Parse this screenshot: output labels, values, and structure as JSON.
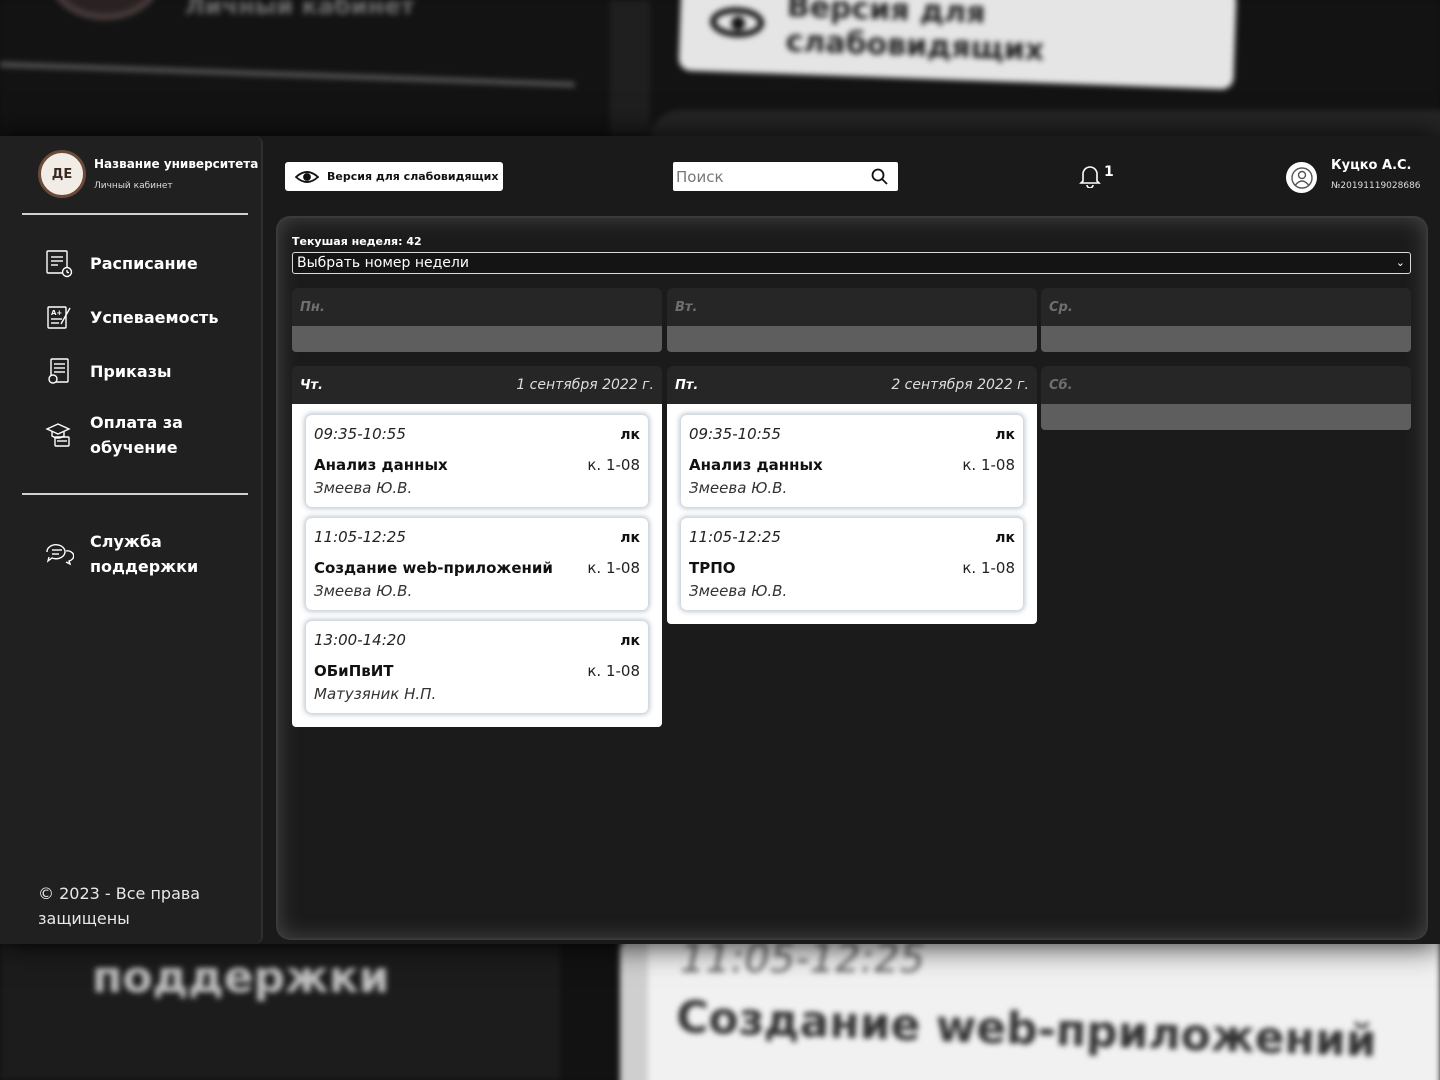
{
  "backdrop": {
    "top_cabinet": "Личный кабинет",
    "top_button": "Версия для слабовидящих",
    "bottom_support": "поддержки",
    "bottom_time": "11:05-12:25",
    "bottom_course": "Создание web-приложений"
  },
  "brand": {
    "university": "Название университета",
    "cabinet": "Личный кабинет",
    "logo_text": "ДЕ"
  },
  "sidebar": {
    "items": [
      {
        "label": "Расписание",
        "icon": "schedule-icon"
      },
      {
        "label": "Успеваемость",
        "icon": "grades-icon"
      },
      {
        "label": "Приказы",
        "icon": "orders-icon"
      },
      {
        "label": "Оплата за обучение",
        "icon": "payment-icon"
      }
    ],
    "support": {
      "label": "Служба поддержки",
      "icon": "support-chat-icon"
    },
    "copyright": "© 2023 - Все права защищены"
  },
  "header": {
    "accessibility_label": "Версия для слабовидящих",
    "search_placeholder": "Поиск",
    "notifications_count": "1",
    "user_name": "Куцко А.С.",
    "user_id": "№20191119028686"
  },
  "schedule": {
    "current_week": "Текушая неделя: 42",
    "week_select": "Выбрать номер недели",
    "days": [
      {
        "name": "Пн.",
        "date": "",
        "lessons": []
      },
      {
        "name": "Вт.",
        "date": "",
        "lessons": []
      },
      {
        "name": "Ср.",
        "date": "",
        "lessons": []
      },
      {
        "name": "Чт.",
        "date": "1 сентября 2022 г.",
        "lessons": [
          {
            "time": "09:35-10:55",
            "type": "лк",
            "name": "Анализ данных",
            "room": "к. 1-08",
            "teacher": "Змеева Ю.В."
          },
          {
            "time": "11:05-12:25",
            "type": "лк",
            "name": "Создание web-приложений",
            "room": "к. 1-08",
            "teacher": "Змеева Ю.В."
          },
          {
            "time": "13:00-14:20",
            "type": "лк",
            "name": "ОБиПвИТ",
            "room": "к. 1-08",
            "teacher": "Матузяник Н.П."
          }
        ]
      },
      {
        "name": "Пт.",
        "date": "2 сентября 2022 г.",
        "lessons": [
          {
            "time": "09:35-10:55",
            "type": "лк",
            "name": "Анализ данных",
            "room": "к. 1-08",
            "teacher": "Змеева Ю.В."
          },
          {
            "time": "11:05-12:25",
            "type": "лк",
            "name": "ТРПО",
            "room": "к. 1-08",
            "teacher": "Змеева Ю.В."
          }
        ]
      },
      {
        "name": "Сб.",
        "date": "",
        "lessons": []
      }
    ]
  },
  "colors": {
    "background": "#1a1a1a",
    "sidebar": "#202020",
    "empty_day_bar": "#5e5e5e",
    "card": "#ffffff"
  }
}
